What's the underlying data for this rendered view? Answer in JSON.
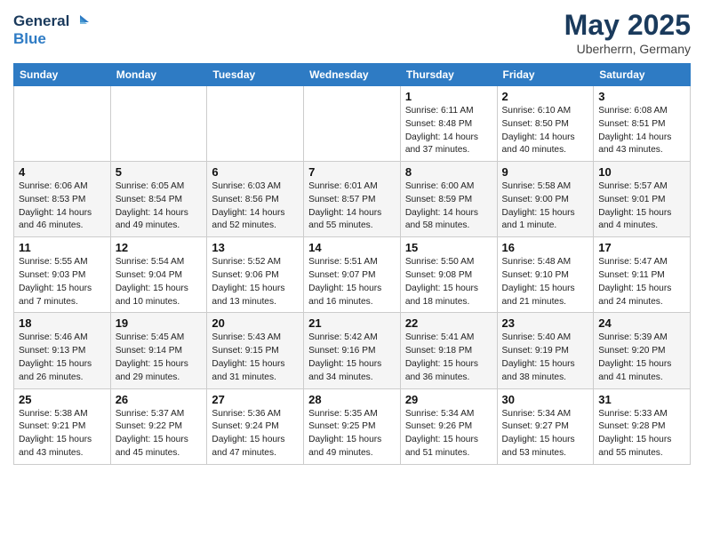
{
  "header": {
    "logo_line1": "General",
    "logo_line2": "Blue",
    "month": "May 2025",
    "location": "Uberherrn, Germany"
  },
  "weekdays": [
    "Sunday",
    "Monday",
    "Tuesday",
    "Wednesday",
    "Thursday",
    "Friday",
    "Saturday"
  ],
  "weeks": [
    [
      {
        "day": "",
        "info": ""
      },
      {
        "day": "",
        "info": ""
      },
      {
        "day": "",
        "info": ""
      },
      {
        "day": "",
        "info": ""
      },
      {
        "day": "1",
        "info": "Sunrise: 6:11 AM\nSunset: 8:48 PM\nDaylight: 14 hours\nand 37 minutes."
      },
      {
        "day": "2",
        "info": "Sunrise: 6:10 AM\nSunset: 8:50 PM\nDaylight: 14 hours\nand 40 minutes."
      },
      {
        "day": "3",
        "info": "Sunrise: 6:08 AM\nSunset: 8:51 PM\nDaylight: 14 hours\nand 43 minutes."
      }
    ],
    [
      {
        "day": "4",
        "info": "Sunrise: 6:06 AM\nSunset: 8:53 PM\nDaylight: 14 hours\nand 46 minutes."
      },
      {
        "day": "5",
        "info": "Sunrise: 6:05 AM\nSunset: 8:54 PM\nDaylight: 14 hours\nand 49 minutes."
      },
      {
        "day": "6",
        "info": "Sunrise: 6:03 AM\nSunset: 8:56 PM\nDaylight: 14 hours\nand 52 minutes."
      },
      {
        "day": "7",
        "info": "Sunrise: 6:01 AM\nSunset: 8:57 PM\nDaylight: 14 hours\nand 55 minutes."
      },
      {
        "day": "8",
        "info": "Sunrise: 6:00 AM\nSunset: 8:59 PM\nDaylight: 14 hours\nand 58 minutes."
      },
      {
        "day": "9",
        "info": "Sunrise: 5:58 AM\nSunset: 9:00 PM\nDaylight: 15 hours\nand 1 minute."
      },
      {
        "day": "10",
        "info": "Sunrise: 5:57 AM\nSunset: 9:01 PM\nDaylight: 15 hours\nand 4 minutes."
      }
    ],
    [
      {
        "day": "11",
        "info": "Sunrise: 5:55 AM\nSunset: 9:03 PM\nDaylight: 15 hours\nand 7 minutes."
      },
      {
        "day": "12",
        "info": "Sunrise: 5:54 AM\nSunset: 9:04 PM\nDaylight: 15 hours\nand 10 minutes."
      },
      {
        "day": "13",
        "info": "Sunrise: 5:52 AM\nSunset: 9:06 PM\nDaylight: 15 hours\nand 13 minutes."
      },
      {
        "day": "14",
        "info": "Sunrise: 5:51 AM\nSunset: 9:07 PM\nDaylight: 15 hours\nand 16 minutes."
      },
      {
        "day": "15",
        "info": "Sunrise: 5:50 AM\nSunset: 9:08 PM\nDaylight: 15 hours\nand 18 minutes."
      },
      {
        "day": "16",
        "info": "Sunrise: 5:48 AM\nSunset: 9:10 PM\nDaylight: 15 hours\nand 21 minutes."
      },
      {
        "day": "17",
        "info": "Sunrise: 5:47 AM\nSunset: 9:11 PM\nDaylight: 15 hours\nand 24 minutes."
      }
    ],
    [
      {
        "day": "18",
        "info": "Sunrise: 5:46 AM\nSunset: 9:13 PM\nDaylight: 15 hours\nand 26 minutes."
      },
      {
        "day": "19",
        "info": "Sunrise: 5:45 AM\nSunset: 9:14 PM\nDaylight: 15 hours\nand 29 minutes."
      },
      {
        "day": "20",
        "info": "Sunrise: 5:43 AM\nSunset: 9:15 PM\nDaylight: 15 hours\nand 31 minutes."
      },
      {
        "day": "21",
        "info": "Sunrise: 5:42 AM\nSunset: 9:16 PM\nDaylight: 15 hours\nand 34 minutes."
      },
      {
        "day": "22",
        "info": "Sunrise: 5:41 AM\nSunset: 9:18 PM\nDaylight: 15 hours\nand 36 minutes."
      },
      {
        "day": "23",
        "info": "Sunrise: 5:40 AM\nSunset: 9:19 PM\nDaylight: 15 hours\nand 38 minutes."
      },
      {
        "day": "24",
        "info": "Sunrise: 5:39 AM\nSunset: 9:20 PM\nDaylight: 15 hours\nand 41 minutes."
      }
    ],
    [
      {
        "day": "25",
        "info": "Sunrise: 5:38 AM\nSunset: 9:21 PM\nDaylight: 15 hours\nand 43 minutes."
      },
      {
        "day": "26",
        "info": "Sunrise: 5:37 AM\nSunset: 9:22 PM\nDaylight: 15 hours\nand 45 minutes."
      },
      {
        "day": "27",
        "info": "Sunrise: 5:36 AM\nSunset: 9:24 PM\nDaylight: 15 hours\nand 47 minutes."
      },
      {
        "day": "28",
        "info": "Sunrise: 5:35 AM\nSunset: 9:25 PM\nDaylight: 15 hours\nand 49 minutes."
      },
      {
        "day": "29",
        "info": "Sunrise: 5:34 AM\nSunset: 9:26 PM\nDaylight: 15 hours\nand 51 minutes."
      },
      {
        "day": "30",
        "info": "Sunrise: 5:34 AM\nSunset: 9:27 PM\nDaylight: 15 hours\nand 53 minutes."
      },
      {
        "day": "31",
        "info": "Sunrise: 5:33 AM\nSunset: 9:28 PM\nDaylight: 15 hours\nand 55 minutes."
      }
    ]
  ]
}
